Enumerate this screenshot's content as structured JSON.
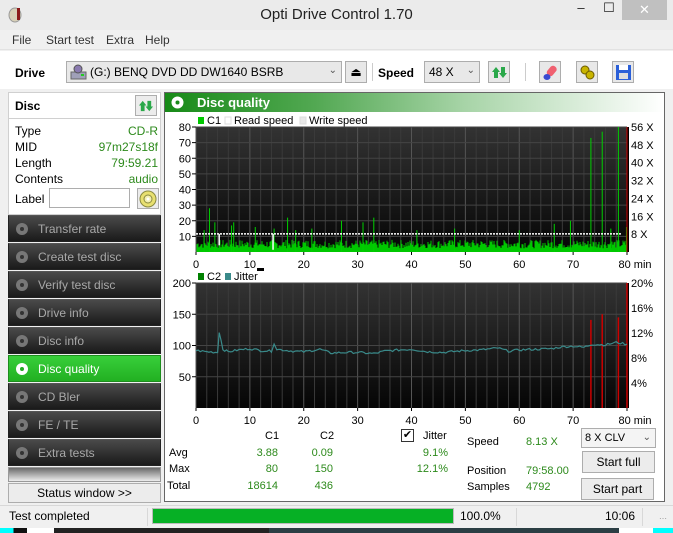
{
  "window": {
    "title": "Opti Drive Control 1.70",
    "controls": {
      "minimize": "–",
      "maximize": "☐",
      "close": "✕"
    }
  },
  "menu": [
    "File",
    "Start test",
    "Extra",
    "Help"
  ],
  "toolbar": {
    "drive_label": "Drive",
    "drive_value": "(G:)  BENQ DVD DD DW1640 BSRB",
    "speed_label": "Speed",
    "speed_value": "48 X",
    "icons": [
      "eject-icon",
      "refresh-icon",
      "erase-icon",
      "settings-icon",
      "save-icon"
    ]
  },
  "disc": {
    "title": "Disc",
    "rows": [
      {
        "key": "Type",
        "value": "CD-R"
      },
      {
        "key": "MID",
        "value": "97m27s18f"
      },
      {
        "key": "Length",
        "value": "79:59.21"
      },
      {
        "key": "Contents",
        "value": "audio"
      }
    ],
    "label_key": "Label",
    "label_value": ""
  },
  "nav": {
    "items": [
      {
        "label": "Transfer rate",
        "active": false
      },
      {
        "label": "Create test disc",
        "active": false
      },
      {
        "label": "Verify test disc",
        "active": false
      },
      {
        "label": "Drive info",
        "active": false
      },
      {
        "label": "Disc info",
        "active": false
      },
      {
        "label": "Disc quality",
        "active": true
      },
      {
        "label": "CD Bler",
        "active": false
      },
      {
        "label": "FE / TE",
        "active": false
      },
      {
        "label": "Extra tests",
        "active": false
      }
    ],
    "status_window": "Status window >>"
  },
  "main": {
    "title": "Disc quality"
  },
  "chart_data": [
    {
      "type": "bar",
      "title": "C1 / Read speed",
      "legend": [
        {
          "name": "C1",
          "color": "#00c800"
        },
        {
          "name": "Read speed",
          "color": "#ffffff"
        },
        {
          "name": "Write speed",
          "color": "#e8e8e8"
        }
      ],
      "legend_placement": "top-left",
      "x_range": [
        0,
        80
      ],
      "x_ticks": [
        0,
        10,
        20,
        30,
        40,
        50,
        60,
        70,
        80
      ],
      "x_unit": "min",
      "y_range": [
        0,
        80
      ],
      "y_ticks": [
        10,
        20,
        30,
        40,
        50,
        60,
        70,
        80
      ],
      "y2_range": [
        0,
        56
      ],
      "y2_ticks": [
        "8 X",
        "16 X",
        "24 X",
        "32 X",
        "40 X",
        "48 X",
        "56 X"
      ],
      "c1_baseline": 6,
      "c1_peaks": [
        {
          "x": 2.5,
          "y": 28
        },
        {
          "x": 1.5,
          "y": 14
        },
        {
          "x": 3.5,
          "y": 19
        },
        {
          "x": 6.6,
          "y": 17
        },
        {
          "x": 7.0,
          "y": 19
        },
        {
          "x": 11,
          "y": 16
        },
        {
          "x": 14.5,
          "y": 15
        },
        {
          "x": 17,
          "y": 22
        },
        {
          "x": 18.5,
          "y": 14
        },
        {
          "x": 21.5,
          "y": 15
        },
        {
          "x": 27,
          "y": 20
        },
        {
          "x": 31,
          "y": 19
        },
        {
          "x": 33,
          "y": 22
        },
        {
          "x": 41,
          "y": 14
        },
        {
          "x": 48,
          "y": 15
        },
        {
          "x": 60,
          "y": 14
        },
        {
          "x": 66.5,
          "y": 18
        },
        {
          "x": 69.5,
          "y": 20
        },
        {
          "x": 73.3,
          "y": 73
        },
        {
          "x": 75.4,
          "y": 77
        },
        {
          "x": 77.0,
          "y": 15
        },
        {
          "x": 78.4,
          "y": 80
        },
        {
          "x": 79.9,
          "y": 16
        }
      ],
      "read_speed_x": 8.13,
      "read_speed_dips": [
        {
          "x": 4.3,
          "speed": 3
        },
        {
          "x": 14.3,
          "speed": 1
        }
      ]
    },
    {
      "type": "line",
      "title": "C2 / Jitter",
      "legend": [
        {
          "name": "C2",
          "color": "#008000"
        },
        {
          "name": "Jitter",
          "color": "#3a8a8a"
        }
      ],
      "legend_placement": "top-left",
      "x_range": [
        0,
        80
      ],
      "x_ticks": [
        0,
        10,
        20,
        30,
        40,
        50,
        60,
        70,
        80
      ],
      "x_unit": "min",
      "y_range": [
        0,
        200
      ],
      "y_ticks": [
        50,
        100,
        150,
        200
      ],
      "y2_range": [
        0,
        20
      ],
      "y2_ticks": [
        "4%",
        "8%",
        "12%",
        "16%",
        "20%"
      ],
      "jitter_points": [
        [
          0,
          9.2
        ],
        [
          2,
          9.0
        ],
        [
          4,
          8.9
        ],
        [
          4.3,
          12.2
        ],
        [
          5,
          9.4
        ],
        [
          6,
          9.0
        ],
        [
          8,
          9.3
        ],
        [
          10,
          9.5
        ],
        [
          12,
          9.2
        ],
        [
          14,
          9.1
        ],
        [
          14.5,
          10.4
        ],
        [
          15,
          9.4
        ],
        [
          18,
          9.1
        ],
        [
          20,
          9.0
        ],
        [
          23,
          9.4
        ],
        [
          25,
          8.8
        ],
        [
          28,
          8.9
        ],
        [
          30,
          8.9
        ],
        [
          33,
          8.7
        ],
        [
          35,
          9.1
        ],
        [
          38,
          9.3
        ],
        [
          40,
          9.4
        ],
        [
          43,
          9.0
        ],
        [
          46,
          8.9
        ],
        [
          50,
          9.2
        ],
        [
          53,
          9.3
        ],
        [
          56,
          9.6
        ],
        [
          58,
          9.1
        ],
        [
          60,
          9.3
        ],
        [
          63,
          9.4
        ],
        [
          66,
          9.5
        ],
        [
          68,
          9.8
        ],
        [
          70,
          9.9
        ],
        [
          72,
          9.7
        ],
        [
          73.5,
          10.2
        ],
        [
          76,
          10.1
        ],
        [
          78,
          10.5
        ],
        [
          80,
          10.2
        ]
      ],
      "c2_spikes": [
        {
          "x": 73.3,
          "y": 141
        },
        {
          "x": 75.4,
          "y": 150
        },
        {
          "x": 78.4,
          "y": 145
        },
        {
          "x": 80,
          "y": 200
        }
      ]
    }
  ],
  "stats": {
    "col_c1": "C1",
    "col_c2": "C2",
    "jitter_label": "Jitter",
    "jitter_checked": true,
    "rows": [
      {
        "label": "Avg",
        "c1": "3.88",
        "c2": "0.09",
        "jitter": "9.1%"
      },
      {
        "label": "Max",
        "c1": "80",
        "c2": "150",
        "jitter": "12.1%"
      },
      {
        "label": "Total",
        "c1": "18614",
        "c2": "436",
        "jitter": ""
      }
    ],
    "speed_label": "Speed",
    "speed_value": "8.13 X",
    "position_label": "Position",
    "position_value": "79:58.00",
    "samples_label": "Samples",
    "samples_value": "4792",
    "speed_mode": "8 X CLV",
    "start_full": "Start full",
    "start_part": "Start part"
  },
  "statusbar": {
    "text": "Test completed",
    "progress": 100.0,
    "progress_text": "100.0%",
    "time": "10:06"
  }
}
